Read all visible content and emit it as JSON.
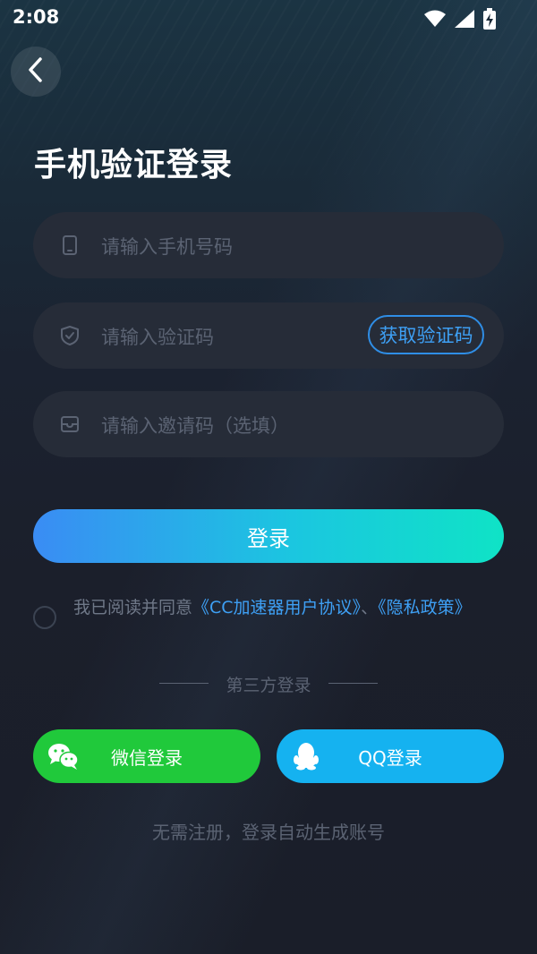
{
  "status_bar": {
    "time": "2:08"
  },
  "title": "手机验证登录",
  "fields": {
    "phone": {
      "placeholder": "请输入手机号码"
    },
    "code": {
      "placeholder": "请输入验证码",
      "get_code_label": "获取验证码"
    },
    "invite": {
      "placeholder": "请输入邀请码（选填）"
    }
  },
  "login_button": "登录",
  "agreement": {
    "prefix": "我已阅读并同意",
    "link_terms": "《CC加速器用户协议》",
    "separator": "、",
    "link_privacy": "《隐私政策》"
  },
  "third_party": {
    "label": "第三方登录",
    "wechat": "微信登录",
    "qq": "QQ登录"
  },
  "footer_note": "无需注册，登录自动生成账号",
  "colors": {
    "accent_blue": "#3ea0f5",
    "wechat_green": "#20c93b",
    "qq_blue": "#15b2f0",
    "gradient_start": "#3a8cf4",
    "gradient_end": "#0fe3c6"
  }
}
